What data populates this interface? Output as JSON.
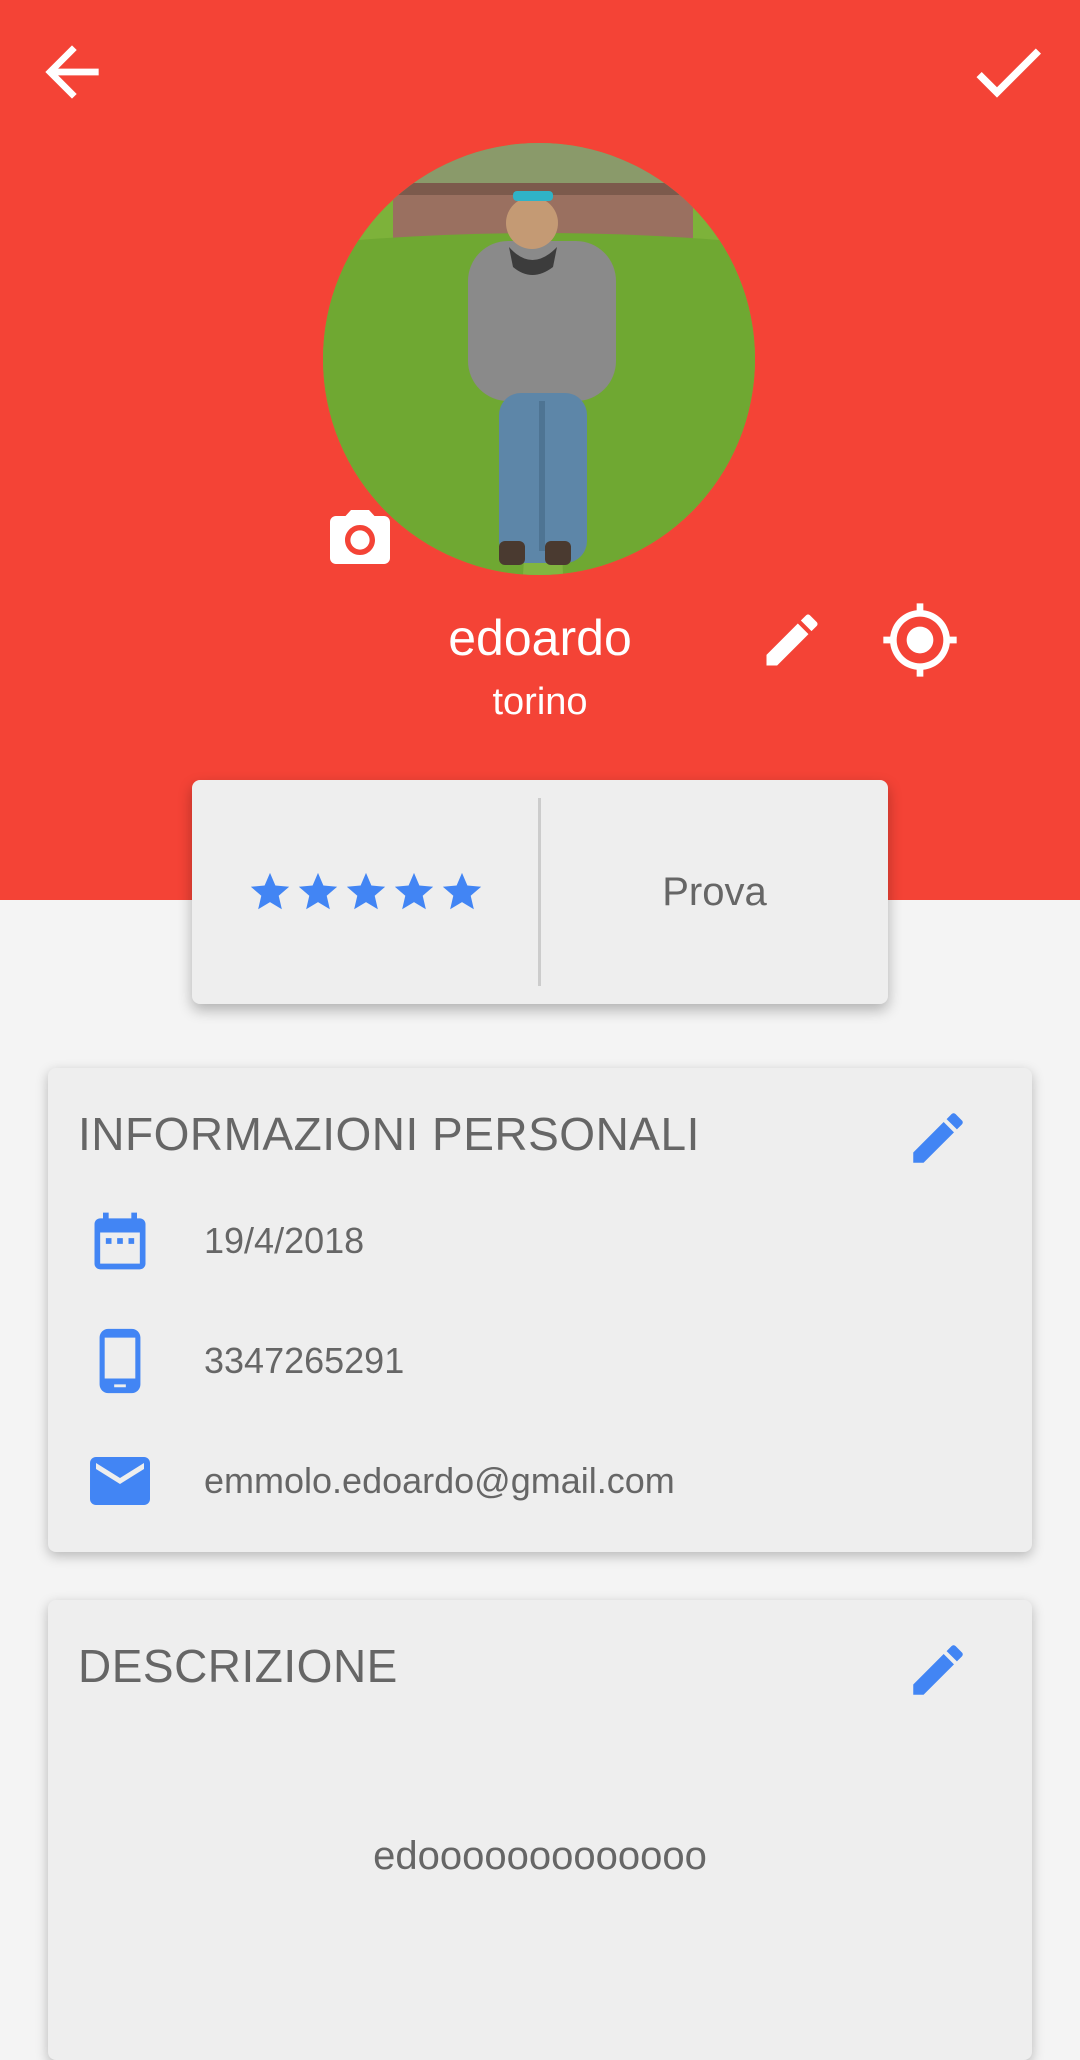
{
  "toolbar": {
    "back_icon": "arrow-back-icon",
    "confirm_icon": "check-icon"
  },
  "profile": {
    "name": "edoardo",
    "city": "torino",
    "photo_icon": "camera-icon",
    "edit_icon": "pencil-icon",
    "location_icon": "gps-target-icon"
  },
  "stats": {
    "rating": 5,
    "rating_max": 5,
    "label": "Prova"
  },
  "personal_info": {
    "title": "INFORMAZIONI PERSONALI",
    "date": "19/4/2018",
    "phone": "3347265291",
    "email": "emmolo.edoardo@gmail.com"
  },
  "description": {
    "title": "DESCRIZIONE",
    "text": "edooooooooooooo"
  },
  "colors": {
    "header_red": "#f44336",
    "accent_blue": "#4285f4",
    "card_bg": "#eeeeee",
    "page_bg": "#f4f4f4",
    "text_gray": "#666666"
  }
}
